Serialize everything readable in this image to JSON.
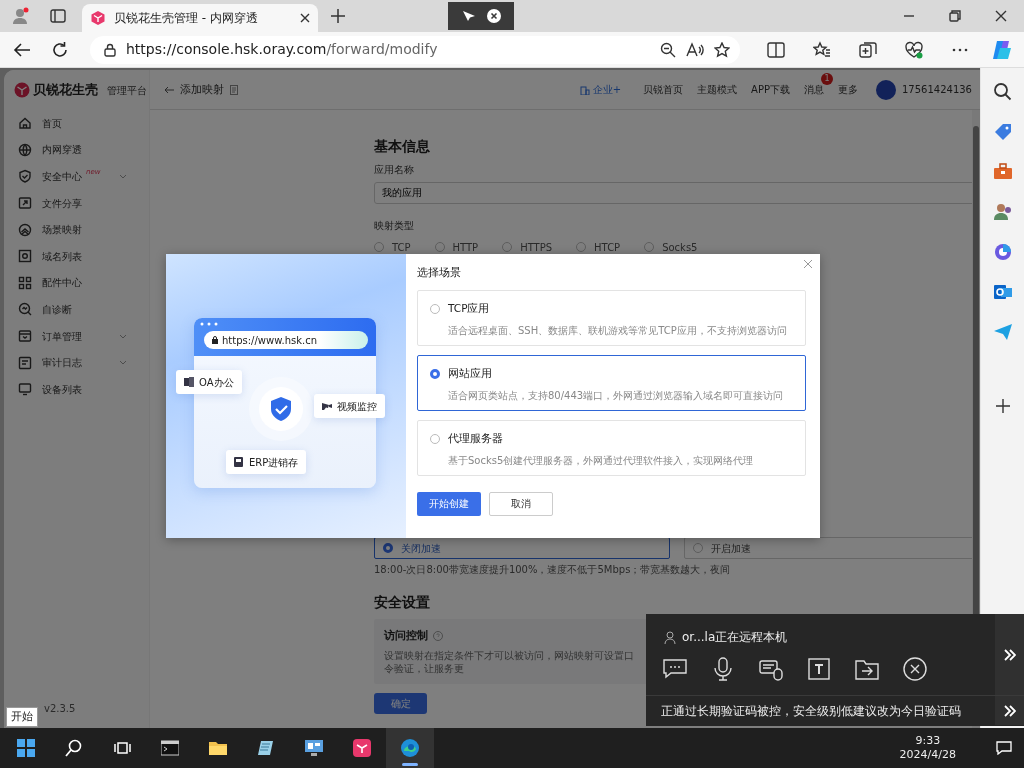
{
  "browser": {
    "tab_title": "贝锐花生壳管理 - 内网穿透",
    "url_host": "https://console.hsk.oray.com",
    "url_path": "/forward/modify"
  },
  "app": {
    "brand": "贝锐花生壳",
    "brand_suffix": "管理平台",
    "page_title": "添加映射",
    "nav": [
      {
        "label": "企业+",
        "kind": "highlight"
      },
      {
        "label": "贝锐首页",
        "kind": "link"
      },
      {
        "label": "主题模式",
        "kind": "link"
      },
      {
        "label": "APP下载",
        "kind": "link"
      },
      {
        "label": "消息",
        "kind": "link",
        "badge": "1"
      },
      {
        "label": "更多",
        "kind": "link"
      }
    ],
    "user": "17561424136",
    "sidebar": [
      {
        "label": "首页",
        "expandable": false
      },
      {
        "label": "内网穿透",
        "expandable": false
      },
      {
        "label": "安全中心",
        "badge": "new",
        "expandable": true
      },
      {
        "label": "文件分享",
        "expandable": false
      },
      {
        "label": "场景映射",
        "expandable": false
      },
      {
        "label": "域名列表",
        "expandable": false
      },
      {
        "label": "配件中心",
        "expandable": false
      },
      {
        "label": "自诊断",
        "expandable": false
      },
      {
        "label": "订单管理",
        "expandable": true
      },
      {
        "label": "审计日志",
        "expandable": true
      },
      {
        "label": "设备列表",
        "expandable": false
      }
    ],
    "version": "v2.3.5",
    "form": {
      "section_title": "基本信息",
      "name_label": "应用名称",
      "name_value": "我的应用",
      "type_label": "映射类型",
      "types": [
        {
          "label": "TCP",
          "selected": false
        },
        {
          "label": "HTTP",
          "selected": false
        },
        {
          "label": "HTTPS",
          "selected": false
        },
        {
          "label": "HTCP",
          "selected": false
        },
        {
          "label": "Socks5",
          "selected": false
        }
      ],
      "speed_options": [
        {
          "label": "关闭加速",
          "selected": true
        },
        {
          "label": "开启加速",
          "selected": false
        }
      ],
      "speed_hint": "18:00-次日8:00带宽速度提升100%，速度不低于5Mbps；带宽基数越大，夜间",
      "security_title": "安全设置",
      "access_title": "访问控制",
      "access_desc": "设置映射在指定条件下才可以被访问，网站映射可设置口令验证，让服务更",
      "submit": "确定"
    }
  },
  "modal": {
    "title": "选择场景",
    "url": "https://www.hsk.cn",
    "tags": [
      "OA办公",
      "视频监控",
      "ERP进销存"
    ],
    "options": [
      {
        "title": "TCP应用",
        "desc": "适合远程桌面、SSH、数据库、联机游戏等常见TCP应用，不支持浏览器访问",
        "selected": false
      },
      {
        "title": "网站应用",
        "desc": "适合网页类站点，支持80/443端口，外网通过浏览器输入域名即可直接访问",
        "selected": true
      },
      {
        "title": "代理服务器",
        "desc": "基于Socks5创建代理服务器，外网通过代理软件接入，实现网络代理",
        "selected": false
      }
    ],
    "primary": "开始创建",
    "secondary": "取消"
  },
  "remote": {
    "user_text": "or...la正在远程本机",
    "warning": "正通过长期验证码被控，安全级别低建议改为今日验证码"
  },
  "tooltip": "开始",
  "taskbar": {
    "time": "9:33",
    "date": "2024/4/28"
  }
}
